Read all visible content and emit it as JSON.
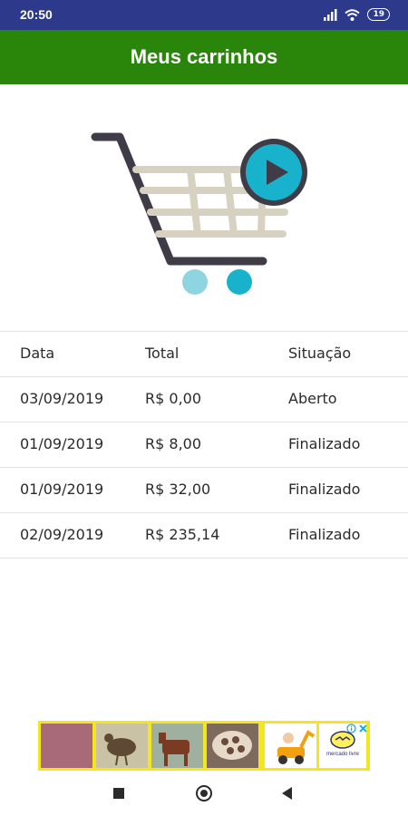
{
  "status_bar": {
    "time": "20:50",
    "battery": "19"
  },
  "app_bar": {
    "title": "Meus carrinhos"
  },
  "table": {
    "headers": [
      "Data",
      "Total",
      "Situação"
    ],
    "rows": [
      [
        "03/09/2019",
        "R$ 0,00",
        "Aberto"
      ],
      [
        "01/09/2019",
        "R$ 8,00",
        "Finalizado"
      ],
      [
        "01/09/2019",
        "R$ 32,00",
        "Finalizado"
      ],
      [
        "02/09/2019",
        "R$ 235,14",
        "Finalizado"
      ]
    ]
  },
  "ad": {
    "brand": "mercado livre"
  },
  "colors": {
    "status_bar": "#2d3a8c",
    "app_bar": "#2a860b",
    "ad_background": "#f4e61c",
    "cart_accent": "#19b2cc"
  },
  "icons": [
    "signal-icon",
    "wifi-icon",
    "battery-icon",
    "shopping-cart-play-icon",
    "ad-info-icon",
    "ad-close-icon",
    "nav-recents-icon",
    "nav-home-icon",
    "nav-back-icon"
  ]
}
